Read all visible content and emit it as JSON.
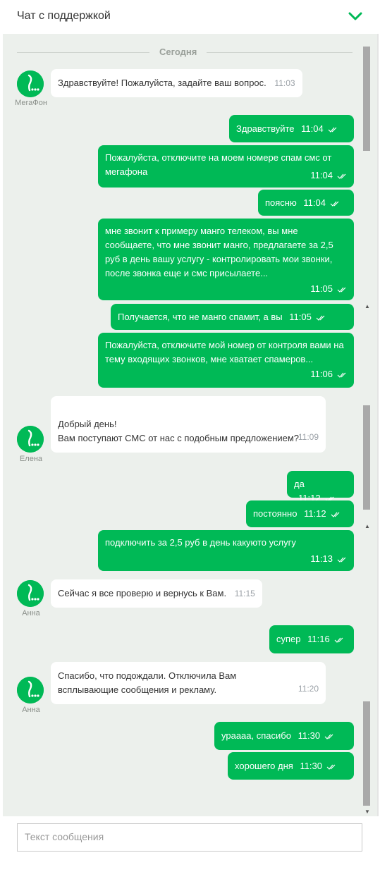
{
  "header": {
    "title": "Чат с поддержкой",
    "collapse_icon": "chevron-down-icon",
    "accent_color": "#00b956"
  },
  "chat": {
    "date_divider": "Сегодня",
    "messages": [
      {
        "dir": "in",
        "author": "МегаФон",
        "text": "Здравствуйте! Пожалуйста, задайте ваш вопрос.",
        "time": "11:03"
      },
      {
        "dir": "out",
        "text": "Здравствуйте",
        "time": "11:04"
      },
      {
        "dir": "out",
        "text": "Пожалуйста, отключите на моем номере спам смс от мегафона",
        "time": "11:04"
      },
      {
        "dir": "out",
        "text": "поясню",
        "time": "11:04"
      },
      {
        "dir": "out",
        "text": "мне звонит к примеру манго телеком, вы мне сообщаете, что мне звонит манго, предлагаете за 2,5 руб в день вашу услугу - контролировать мои звонки, после звонка еще и смс присылаете...",
        "time": "11:05"
      },
      {
        "dir": "out",
        "text": "Получается, что не манго спамит, а вы",
        "time": "11:05"
      },
      {
        "dir": "out",
        "text": "Пожалуйста, отключите мой номер от контроля вами на тему входящих звонков, мне хватает спамеров...",
        "time": "11:06"
      },
      {
        "dir": "in",
        "author": "Елена",
        "text": "Добрый день!\nВам поступают СМС от нас с подобным предложением?",
        "time": "11:09"
      },
      {
        "dir": "out",
        "text": "да",
        "time": "11:12"
      },
      {
        "dir": "out",
        "text": "постоянно",
        "time": "11:12"
      },
      {
        "dir": "out",
        "text": "подключить за 2,5 руб в день какуюто услугу",
        "time": "11:13"
      },
      {
        "dir": "in",
        "author": "Анна",
        "text": "Сейчас я все проверю и вернусь к Вам.",
        "time": "11:15"
      },
      {
        "dir": "out",
        "text": "супер",
        "time": "11:16"
      },
      {
        "dir": "in",
        "author": "Анна",
        "text": "Спасибо, что подождали. Отключила Вам всплывающие сообщения и рекламу.",
        "time": "11:20"
      },
      {
        "dir": "out",
        "text": "урaaaa, спасибо",
        "time": "11:30"
      },
      {
        "dir": "out",
        "text": "хорошего дня",
        "time": "11:30"
      }
    ]
  },
  "composer": {
    "placeholder": "Текст сообщения"
  },
  "colors": {
    "outgoing_bubble": "#00b956",
    "incoming_bubble": "#ffffff",
    "chat_background": "#ecf0ec"
  }
}
